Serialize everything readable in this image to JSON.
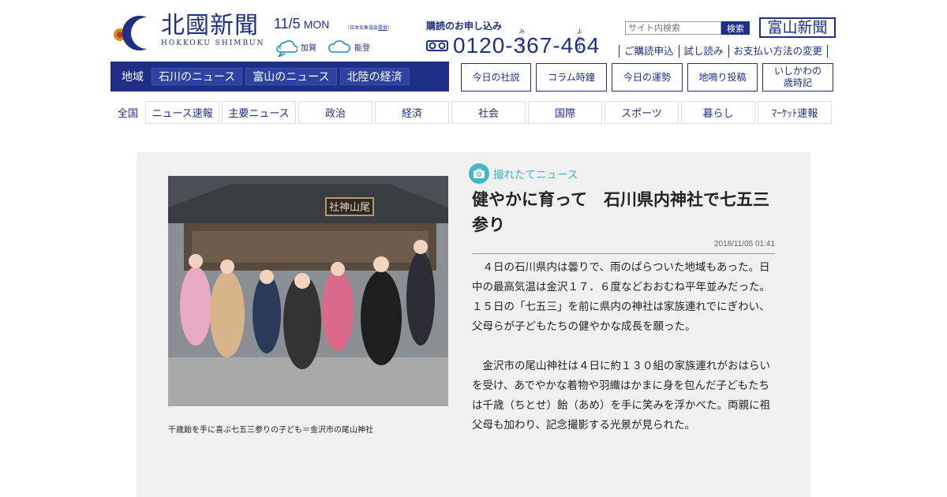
{
  "header": {
    "logo_jp": "北國新聞",
    "logo_en": "HOKKOKU SHIMBUN",
    "date": "11/5",
    "weekday": "MON",
    "jma_credit": "（日本気象協会",
    "jma_link": "提供",
    "jma_close": "）",
    "weather": [
      {
        "area": "加賀",
        "icon": "cloud-sun-icon"
      },
      {
        "area": "能登",
        "icon": "cloud-icon"
      }
    ],
    "subscribe_title": "購読のお申し込み",
    "ruby_1": "みんな",
    "ruby_2": "よむよ",
    "phone": "0120-367-464",
    "search_placeholder": "サイト内検索",
    "search_button": "検索",
    "toyama_logo": "富山新聞",
    "links": [
      "ご購読申込",
      "試し読み",
      "お支払い方法の変更"
    ]
  },
  "region": {
    "label": "地域",
    "buttons": [
      "石川のニュース",
      "富山のニュース",
      "北陸の経済"
    ]
  },
  "boxes": [
    {
      "label": "今日の社説"
    },
    {
      "label": "コラム時鐘"
    },
    {
      "label": "今日の運勢"
    },
    {
      "label": "地鳴り投稿"
    },
    {
      "label_1": "いしかわの",
      "label_2": "歳時記"
    }
  ],
  "categories": {
    "label": "全国",
    "items": [
      "ニュース速報",
      "主要ニュース",
      "政治",
      "経済",
      "社会",
      "国際",
      "スポーツ",
      "暮らし",
      "ﾏｰｹｯﾄ速報"
    ]
  },
  "article": {
    "tag": "撮れたてニュース",
    "headline": "健やかに育って　石川県内神社で七五三参り",
    "timestamp": "2018/11/05 01:41",
    "paragraphs": [
      "４日の石川県内は曇りで、雨のぱらついた地域もあった。日中の最高気温は金沢１７．６度などおおむね平年並みだった。１５日の「七五三」を前に県内の神社は家族連れでにぎわい、父母らが子どもたちの健やかな成長を願った。",
      "金沢市の尾山神社は４日に約１３０組の家族連れがおはらいを受け、あでやかな着物や羽織はかまに身を包んだ子どもたちは千歳（ちとせ）飴（あめ）を手に笑みを浮かべた。両親に祖父母も加わり、記念撮影する光景が見られた。"
    ],
    "caption": "千歳飴を手に喜ぶ七五三参りの子ども＝金沢市の尾山神社",
    "shrine_plaque": "社神山尾"
  },
  "colors": {
    "brand": "#1f2f85",
    "accent": "#3fb8c8",
    "article_bg": "#f0f0f0"
  }
}
